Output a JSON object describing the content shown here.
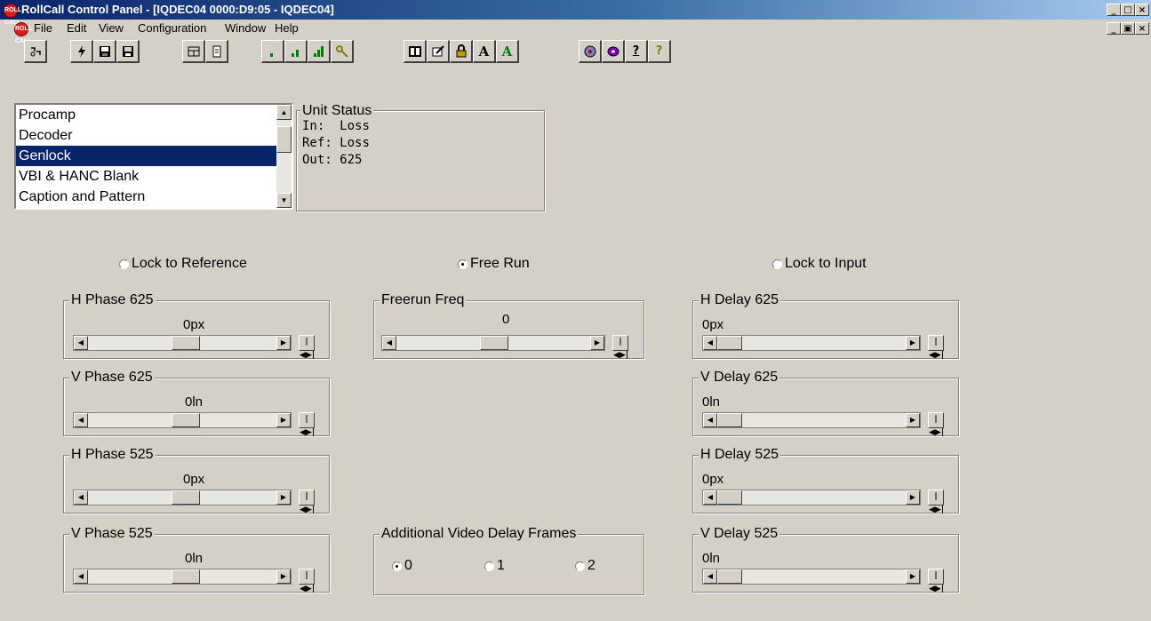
{
  "window": {
    "title": "RollCall Control Panel - [IQDEC04 0000:D9:05 - IQDEC04]",
    "app_icon_text": "ROLL CALL",
    "controls": [
      "_",
      "□",
      "×"
    ],
    "mdi_controls": [
      "_",
      "▣",
      "×"
    ]
  },
  "menu": {
    "items": [
      "File",
      "Edit",
      "View",
      "Configuration",
      "Window",
      "Help"
    ]
  },
  "toolbar": {
    "buttons": [
      "connect-icon",
      "lightning-icon",
      "save-icon",
      "save-all-icon",
      "layout-icon",
      "page-icon",
      "level1-icon",
      "level2-icon",
      "level3-icon",
      "key-icon",
      "book-icon",
      "edit-icon",
      "lock-icon",
      "font-a-icon",
      "font-a-green-icon",
      "network-icon",
      "disk-icon",
      "info-icon",
      "help-icon"
    ],
    "glyphs": {
      "font_a": "A",
      "info": "?",
      "help": "?"
    }
  },
  "module_list": {
    "items": [
      "Procamp",
      "Decoder",
      "Genlock",
      "VBI & HANC Blank",
      "Caption and Pattern"
    ],
    "selected": "Genlock"
  },
  "unit_status": {
    "label": "Unit Status",
    "in_label": "In:",
    "in_value": "Loss",
    "ref_label": "Ref:",
    "ref_value": "Loss",
    "out_label": "Out:",
    "out_value": "625"
  },
  "genlock_mode": {
    "lock_to_reference": "Lock to Reference",
    "free_run": "Free Run",
    "lock_to_input": "Lock to Input",
    "selected": "Free Run"
  },
  "phase_controls": [
    {
      "label": "H Phase 625",
      "value": "0px"
    },
    {
      "label": "V Phase 625",
      "value": "0ln"
    },
    {
      "label": "H Phase 525",
      "value": "0px"
    },
    {
      "label": "V Phase 525",
      "value": "0ln"
    }
  ],
  "freerun": {
    "label": "Freerun Freq",
    "value": "0"
  },
  "delay_controls": [
    {
      "label": "H Delay 625",
      "value": "0px"
    },
    {
      "label": "V Delay 625",
      "value": "0ln"
    },
    {
      "label": "H Delay 525",
      "value": "0px"
    },
    {
      "label": "V Delay 525",
      "value": "0ln"
    }
  ],
  "video_delay": {
    "label": "Additional Video Delay Frames",
    "options": [
      "0",
      "1",
      "2"
    ],
    "selected": "0"
  },
  "scroll_glyphs": {
    "left": "◀",
    "right": "▶",
    "up": "▲",
    "down": "▼",
    "reset": "|◀▶|"
  }
}
